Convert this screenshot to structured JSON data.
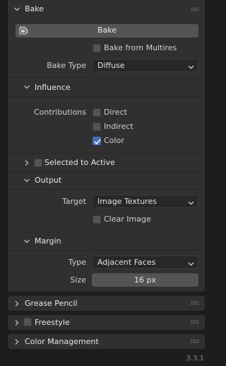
{
  "bake": {
    "title": "Bake",
    "button_label": "Bake",
    "bake_from_multires_label": "Bake from Multires",
    "bake_type_label": "Bake Type",
    "bake_type_value": "Diffuse"
  },
  "influence": {
    "title": "Influence",
    "contributions_label": "Contributions",
    "direct_label": "Direct",
    "indirect_label": "Indirect",
    "color_label": "Color"
  },
  "selected_to_active": {
    "title": "Selected to Active"
  },
  "output": {
    "title": "Output",
    "target_label": "Target",
    "target_value": "Image Textures",
    "clear_image_label": "Clear Image"
  },
  "margin": {
    "title": "Margin",
    "type_label": "Type",
    "type_value": "Adjacent Faces",
    "size_label": "Size",
    "size_value": "16 px"
  },
  "panels": {
    "grease_pencil": "Grease Pencil",
    "freestyle": "Freestyle",
    "color_management": "Color Management"
  },
  "status": {
    "version": "3.3.1"
  },
  "states": {
    "bake_from_multires": false,
    "direct": false,
    "indirect": false,
    "color": true,
    "selected_to_active": false,
    "clear_image": false,
    "freestyle": false
  },
  "colors": {
    "accent": "#4772b3",
    "panel_bg": "#303030",
    "background": "#1d1d1d"
  }
}
